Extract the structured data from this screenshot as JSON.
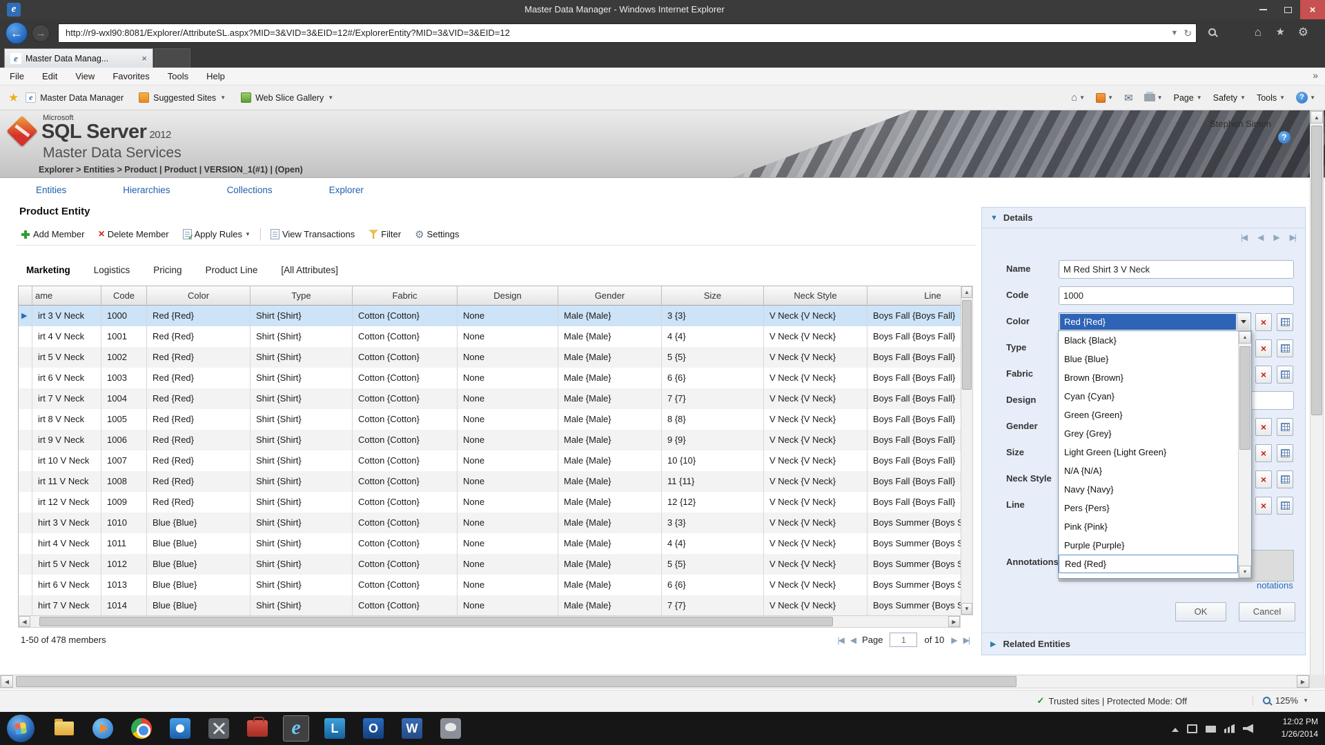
{
  "icons": {
    "close": "×",
    "check": "✓",
    "caret_down": "▼",
    "caret_up": "▲",
    "left": "◀",
    "right": "▶",
    "first": "|◀",
    "last": "▶|",
    "back": "←",
    "forward": "→",
    "refresh": "↻",
    "home": "⌂",
    "star": "★",
    "gear": "⚙",
    "mail": "✉",
    "help": "?",
    "chevrons": "»",
    "ie_letter": "e",
    "word_letter": "W",
    "outlook_letter": "O",
    "lync_letter": "L"
  },
  "titlebar": {
    "title": "Master Data Manager - Windows Internet Explorer"
  },
  "address": {
    "url": "http://r9-wxl90:8081/Explorer/AttributeSL.aspx?MID=3&VID=3&EID=12#/ExplorerEntity?MID=3&VID=3&EID=12"
  },
  "tab": {
    "title": "Master Data Manag..."
  },
  "menubar": {
    "items": [
      "File",
      "Edit",
      "View",
      "Favorites",
      "Tools",
      "Help"
    ]
  },
  "favbar": {
    "items": [
      "Master Data Manager",
      "Suggested Sites",
      "Web Slice Gallery"
    ],
    "right_items": [
      "Page",
      "Safety",
      "Tools"
    ]
  },
  "header": {
    "microsoft": "Microsoft",
    "product": "SQL Server",
    "year": "2012",
    "subtitle": "Master Data Services",
    "user": "Stephen Simon",
    "breadcrumb": "Explorer  >  Entities  >  Product  |  Product  |  VERSION_1(#1)  |  (Open)"
  },
  "nav": {
    "items": [
      "Entities",
      "Hierarchies",
      "Collections",
      "Explorer"
    ]
  },
  "page": {
    "title": "Product Entity",
    "toolbar": {
      "add": "Add Member",
      "delete": "Delete Member",
      "apply_rules": "Apply Rules",
      "view_transactions": "View Transactions",
      "filter": "Filter",
      "settings": "Settings"
    },
    "tabs": [
      "Marketing",
      "Logistics",
      "Pricing",
      "Product Line",
      "[All Attributes]"
    ]
  },
  "grid": {
    "columns": [
      "ame",
      "Code",
      "Color",
      "Type",
      "Fabric",
      "Design",
      "Gender",
      "Size",
      "Neck Style",
      "Line"
    ],
    "selected_row_index": 0,
    "rows": [
      [
        "irt 3 V Neck",
        "1000",
        "Red {Red}",
        "Shirt {Shirt}",
        "Cotton {Cotton}",
        "None",
        "Male {Male}",
        "3 {3}",
        "V Neck {V Neck}",
        "Boys Fall {Boys Fall}"
      ],
      [
        "irt 4 V Neck",
        "1001",
        "Red {Red}",
        "Shirt {Shirt}",
        "Cotton {Cotton}",
        "None",
        "Male {Male}",
        "4 {4}",
        "V Neck {V Neck}",
        "Boys Fall {Boys Fall}"
      ],
      [
        "irt 5 V Neck",
        "1002",
        "Red {Red}",
        "Shirt {Shirt}",
        "Cotton {Cotton}",
        "None",
        "Male {Male}",
        "5 {5}",
        "V Neck {V Neck}",
        "Boys Fall {Boys Fall}"
      ],
      [
        "irt 6 V Neck",
        "1003",
        "Red {Red}",
        "Shirt {Shirt}",
        "Cotton {Cotton}",
        "None",
        "Male {Male}",
        "6 {6}",
        "V Neck {V Neck}",
        "Boys Fall {Boys Fall}"
      ],
      [
        "irt 7 V Neck",
        "1004",
        "Red {Red}",
        "Shirt {Shirt}",
        "Cotton {Cotton}",
        "None",
        "Male {Male}",
        "7 {7}",
        "V Neck {V Neck}",
        "Boys Fall {Boys Fall}"
      ],
      [
        "irt 8 V Neck",
        "1005",
        "Red {Red}",
        "Shirt {Shirt}",
        "Cotton {Cotton}",
        "None",
        "Male {Male}",
        "8 {8}",
        "V Neck {V Neck}",
        "Boys Fall {Boys Fall}"
      ],
      [
        "irt 9 V Neck",
        "1006",
        "Red {Red}",
        "Shirt {Shirt}",
        "Cotton {Cotton}",
        "None",
        "Male {Male}",
        "9 {9}",
        "V Neck {V Neck}",
        "Boys Fall {Boys Fall}"
      ],
      [
        "irt 10 V Neck",
        "1007",
        "Red {Red}",
        "Shirt {Shirt}",
        "Cotton {Cotton}",
        "None",
        "Male {Male}",
        "10 {10}",
        "V Neck {V Neck}",
        "Boys Fall {Boys Fall}"
      ],
      [
        "irt 11 V Neck",
        "1008",
        "Red {Red}",
        "Shirt {Shirt}",
        "Cotton {Cotton}",
        "None",
        "Male {Male}",
        "11 {11}",
        "V Neck {V Neck}",
        "Boys Fall {Boys Fall}"
      ],
      [
        "irt 12 V Neck",
        "1009",
        "Red {Red}",
        "Shirt {Shirt}",
        "Cotton {Cotton}",
        "None",
        "Male {Male}",
        "12 {12}",
        "V Neck {V Neck}",
        "Boys Fall {Boys Fall}"
      ],
      [
        "hirt 3 V Neck",
        "1010",
        "Blue {Blue}",
        "Shirt {Shirt}",
        "Cotton {Cotton}",
        "None",
        "Male {Male}",
        "3 {3}",
        "V Neck {V Neck}",
        "Boys Summer {Boys Summer}"
      ],
      [
        "hirt 4 V Neck",
        "1011",
        "Blue {Blue}",
        "Shirt {Shirt}",
        "Cotton {Cotton}",
        "None",
        "Male {Male}",
        "4 {4}",
        "V Neck {V Neck}",
        "Boys Summer {Boys Summer}"
      ],
      [
        "hirt 5 V Neck",
        "1012",
        "Blue {Blue}",
        "Shirt {Shirt}",
        "Cotton {Cotton}",
        "None",
        "Male {Male}",
        "5 {5}",
        "V Neck {V Neck}",
        "Boys Summer {Boys Summer}"
      ],
      [
        "hirt 6 V Neck",
        "1013",
        "Blue {Blue}",
        "Shirt {Shirt}",
        "Cotton {Cotton}",
        "None",
        "Male {Male}",
        "6 {6}",
        "V Neck {V Neck}",
        "Boys Summer {Boys Summer}"
      ],
      [
        "hirt 7 V Neck",
        "1014",
        "Blue {Blue}",
        "Shirt {Shirt}",
        "Cotton {Cotton}",
        "None",
        "Male {Male}",
        "7 {7}",
        "V Neck {V Neck}",
        "Boys Summer {Boys Summer}"
      ]
    ],
    "status": "1-50 of 478 members",
    "pagination": {
      "page_label": "Page",
      "page_value": "1",
      "of_label": "of 10"
    }
  },
  "details": {
    "title": "Details",
    "fields": [
      {
        "label": "Name",
        "value": "M Red Shirt 3 V Neck"
      },
      {
        "label": "Code",
        "value": "1000"
      },
      {
        "label": "Color",
        "value": "Red {Red}"
      },
      {
        "label": "Type"
      },
      {
        "label": "Fabric"
      },
      {
        "label": "Design",
        "value": ""
      },
      {
        "label": "Gender"
      },
      {
        "label": "Size"
      },
      {
        "label": "Neck Style"
      },
      {
        "label": "Line"
      }
    ],
    "annotations_label": "Annotations",
    "annotations_link": "notations",
    "dropdown": {
      "options": [
        "Black {Black}",
        "Blue {Blue}",
        "Brown {Brown}",
        "Cyan {Cyan}",
        "Green {Green}",
        "Grey {Grey}",
        "Light Green {Light Green}",
        "N/A {N/A}",
        "Navy {Navy}",
        "Pers {Pers}",
        "Pink {Pink}",
        "Purple {Purple}",
        "Red {Red}"
      ],
      "highlighted": "Red {Red}"
    },
    "ok": "OK",
    "cancel": "Cancel",
    "related": "Related Entities"
  },
  "statusbar": {
    "left": "Trusted sites | Protected Mode: Off",
    "zoom": "125%"
  },
  "taskbar": {
    "time": "12:02 PM",
    "date": "1/26/2014"
  }
}
